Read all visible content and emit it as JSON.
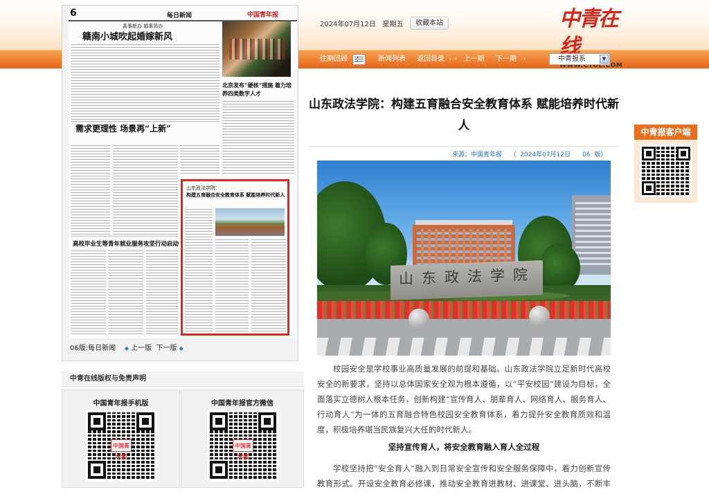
{
  "header": {
    "date": "2024年07月12日",
    "weekday": "星期五",
    "bookmark_label": "收藏本站",
    "logo_text": "中青在线",
    "logo_url": "WWW.CYOL.COM"
  },
  "nav": {
    "prev_date": "往期回顾",
    "news_list": "新闻列表",
    "back_to_index": "返回目录",
    "prev_issue": "上一期",
    "next_issue": "下一期",
    "paper_select": "中青报系"
  },
  "newspaper": {
    "page_number": "6",
    "column": "每日新闻",
    "headline_main": "赣南小城吹起婚嫁新风",
    "headline_kicker": "喜事新办 婚事简办",
    "headline_2": "需求更理性 场景再“上新”",
    "headline_3": "高校毕业生等青年就业服务攻坚行动启动",
    "headline_4": "北京发布“硬核”措施 着力培养四类数字人才",
    "highlight_kicker": "山东政法学院：",
    "highlight_title": "构建五育融合安全教育体系 赋能培养时代新人",
    "footer_label": "06版:每日新闻",
    "prev_page": "上一版",
    "next_page": "下一版"
  },
  "sidebar": {
    "disclaimer_title": "中青在线版权与免责声明",
    "qr_left_title": "中国青年报手机版",
    "qr_right_title": "中国青年报官方微信",
    "qr_logo": "中国青年报"
  },
  "article": {
    "title": "山东政法学院：构建五育融合安全教育体系 赋能培养时代新人",
    "source": "来源：中国青年报",
    "date_page": "（  2024年07月12日      06  版）",
    "photo_sign": "山东政法学院",
    "paragraph1": "校园安全是学校事业高质量发展的前提和基础。山东政法学院立足新时代高校安全的新要求，坚持以总体国家安全观为根本遵循，以“平安校园”建设为目标，全面落实立德树人根本任务，创新构建“宣传育人、朋辈育人、网络育人、服务育人、行动育人”为一体的五育融合特色校园安全教育体系，着力提升安全教育质效和温度，积极培养堪当民族复兴大任的时代新人。",
    "subheading": "坚持宣传育人，将安全教育融入育人全过程",
    "paragraph2": "学校坚持把“安全育人”融入到日常安全宣传和安全服务保障中，着力创新宣传教育形式。开设安全教育必修课，推动安全教育进教材、进课堂、进头脑，不断丰富"
  },
  "client": {
    "title": "中青报客户端"
  },
  "colors": {
    "accent_orange": "#e8711f",
    "link_blue": "#1f73b7",
    "highlight_red": "#e6221b"
  }
}
